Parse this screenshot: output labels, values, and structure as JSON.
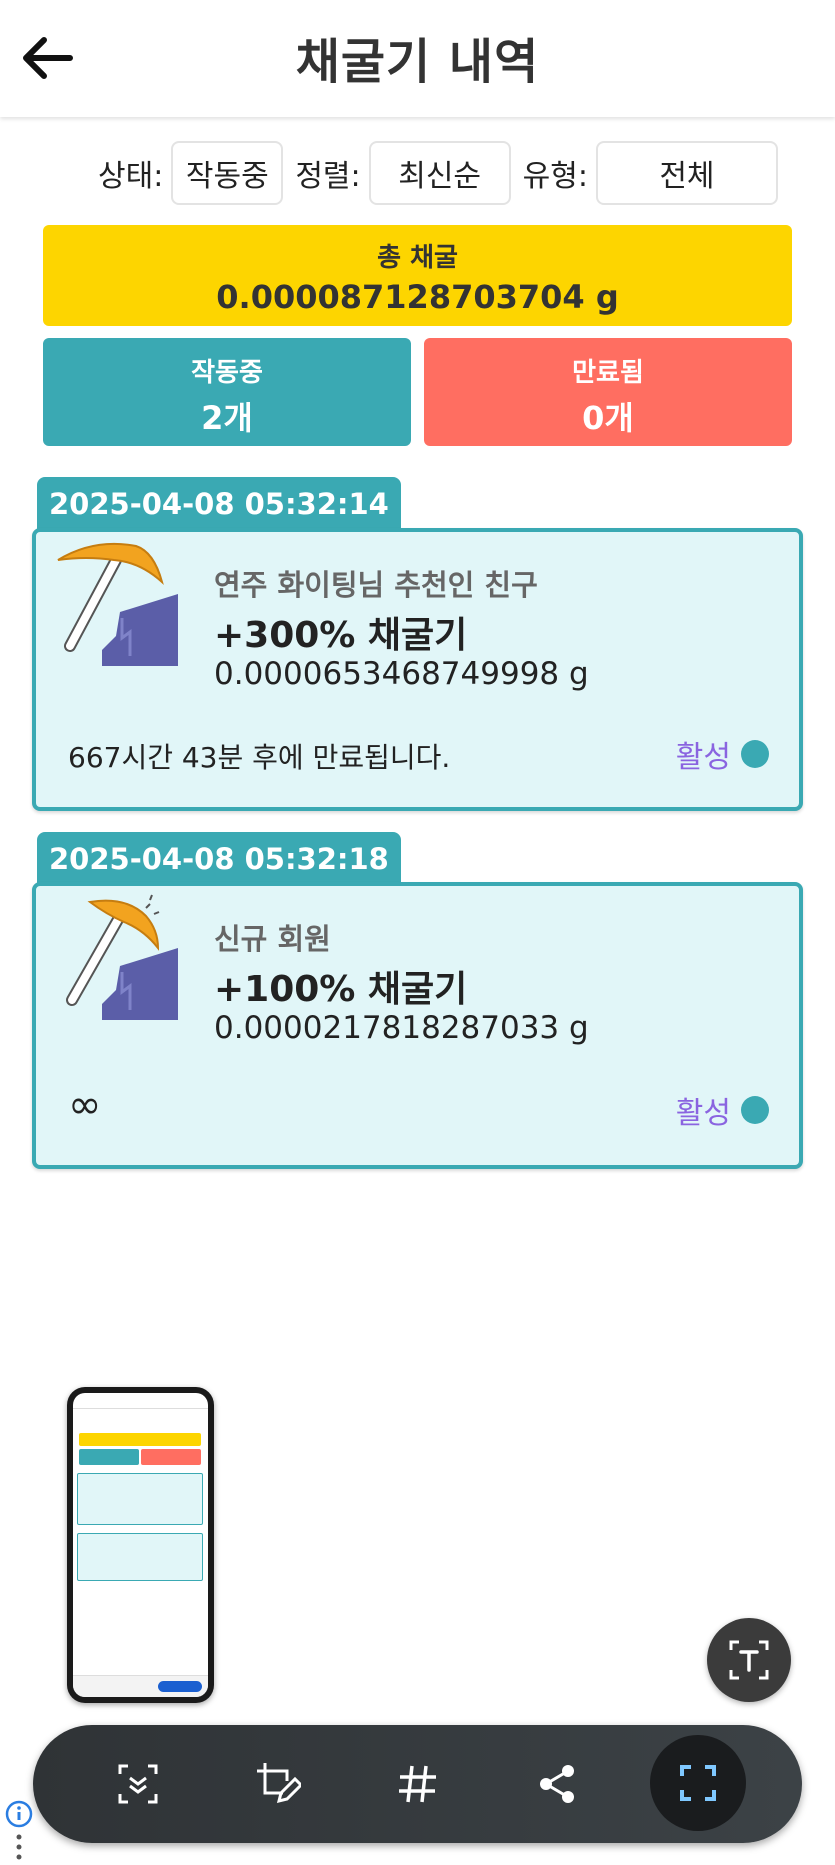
{
  "header": {
    "title": "채굴기 내역",
    "back_icon": "arrow-left-icon"
  },
  "filters": [
    {
      "label": "상태:",
      "value": "작동중"
    },
    {
      "label": "정렬:",
      "value": "최신순"
    },
    {
      "label": "유형:",
      "value": "전체"
    }
  ],
  "total": {
    "label": "총 채굴",
    "value": "0.000087128703704 g"
  },
  "stats": {
    "active": {
      "label": "작동중",
      "value": "2개"
    },
    "expired": {
      "label": "만료됨",
      "value": "0개"
    }
  },
  "cards": [
    {
      "date": "2025-04-08 05:32:14",
      "subtitle": "연주 화이팅님 추천인 친구",
      "title": "+300% 채굴기",
      "amount": "0.0000653468749998 g",
      "expire": "667시간 43분 후에 만료됩니다.",
      "status": "활성",
      "icon": "pickaxe-rock-icon"
    },
    {
      "date": "2025-04-08 05:32:18",
      "subtitle": "신규 회원",
      "title": "+100% 채굴기",
      "amount": "0.0000217818287033 g",
      "expire": "∞",
      "status": "활성",
      "icon": "pickaxe-rock-icon"
    }
  ],
  "toolbar": {
    "icons": [
      "scroll-capture-icon",
      "crop-edit-icon",
      "hashtag-icon",
      "share-icon",
      "capture-icon"
    ],
    "ocr_icon": "text-extract-icon"
  },
  "colors": {
    "accent": "#3aa9b3",
    "total": "#fdd500",
    "expired": "#ff6e61",
    "status_text": "#8a64e0"
  }
}
